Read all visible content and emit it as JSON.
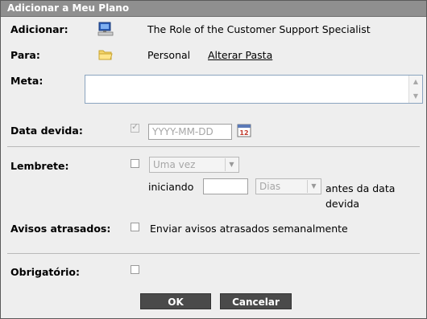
{
  "window": {
    "title": "Adicionar a Meu Plano"
  },
  "add": {
    "label": "Adicionar:",
    "value": "The Role of the Customer Support Specialist",
    "icon": "computer-icon"
  },
  "to": {
    "label": "Para:",
    "folder": "Personal",
    "change_link": "Alterar Pasta",
    "icon": "folder-icon"
  },
  "goal": {
    "label": "Meta:",
    "value": ""
  },
  "due": {
    "label": "Data devida:",
    "checked": true,
    "placeholder": "YYYY-MM-DD",
    "calendar_icon_text": "12",
    "icon": "calendar-icon"
  },
  "reminder": {
    "label": "Lembrete:",
    "checked": false,
    "frequency": "Uma vez",
    "starting_label": "iniciando",
    "days_value": "",
    "unit": "Dias",
    "suffix": "antes da data devida"
  },
  "overdue": {
    "label": "Avisos atrasados:",
    "checked": false,
    "text": "Enviar avisos atrasados semanalmente"
  },
  "required": {
    "label": "Obrigatório:",
    "checked": false
  },
  "buttons": {
    "ok": "OK",
    "cancel": "Cancelar"
  },
  "colors": {
    "title_bar": "#8f8f8f",
    "button": "#4a4a4a",
    "background": "#eeeeee"
  }
}
